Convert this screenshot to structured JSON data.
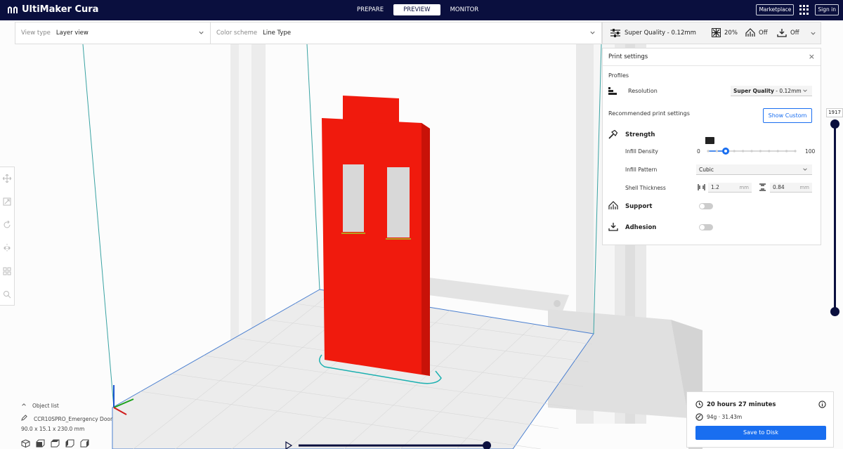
{
  "app": {
    "title": "UltiMaker Cura"
  },
  "stages": [
    {
      "label": "PREPARE",
      "active": false
    },
    {
      "label": "PREVIEW",
      "active": true
    },
    {
      "label": "MONITOR",
      "active": false
    }
  ],
  "header": {
    "marketplace_label": "Marketplace",
    "signin_label": "Sign in"
  },
  "view_options": {
    "view_type_label": "View type",
    "view_type_value": "Layer view",
    "color_scheme_label": "Color scheme",
    "color_scheme_value": "Line Type"
  },
  "quality_bar": {
    "profile": "Super Quality - 0.12mm",
    "infill": "20%",
    "support": "Off",
    "adhesion": "Off"
  },
  "print_settings": {
    "title": "Print settings",
    "profiles_heading": "Profiles",
    "resolution_label": "Resolution",
    "resolution_value_bold": "Super Quality",
    "resolution_value_rest": " - 0.12mm",
    "recommended_heading": "Recommended print settings",
    "show_custom_label": "Show Custom",
    "strength_label": "Strength",
    "infill_density_label": "Infill Density",
    "infill_density_value": 20,
    "infill_tooltip": "20%",
    "infill_min": "0",
    "infill_max": "100",
    "infill_pattern_label": "Infill Pattern",
    "infill_pattern_value": "Cubic",
    "shell_thickness_label": "Shell Thickness",
    "wall_thickness": "1.2",
    "top_bottom_thickness": "0.84",
    "unit": "mm",
    "support_label": "Support",
    "support_enabled": false,
    "adhesion_label": "Adhesion",
    "adhesion_enabled": false
  },
  "layer_slider": {
    "current_layer": "1917"
  },
  "object_list": {
    "toggle_label": "Object list",
    "object_name": "CCR10SPRO_Emergency Door",
    "dimensions": "90.0 x 15.1 x 230.0 mm"
  },
  "print_info": {
    "time": "20 hours 27 minutes",
    "material": "94g · 31.43m",
    "save_label": "Save to Disk"
  },
  "colors": {
    "header_bg": "#0a0f3e",
    "accent": "#196ef0",
    "model_red": "#f01a0d",
    "build_plate": "#e6e6e6"
  }
}
